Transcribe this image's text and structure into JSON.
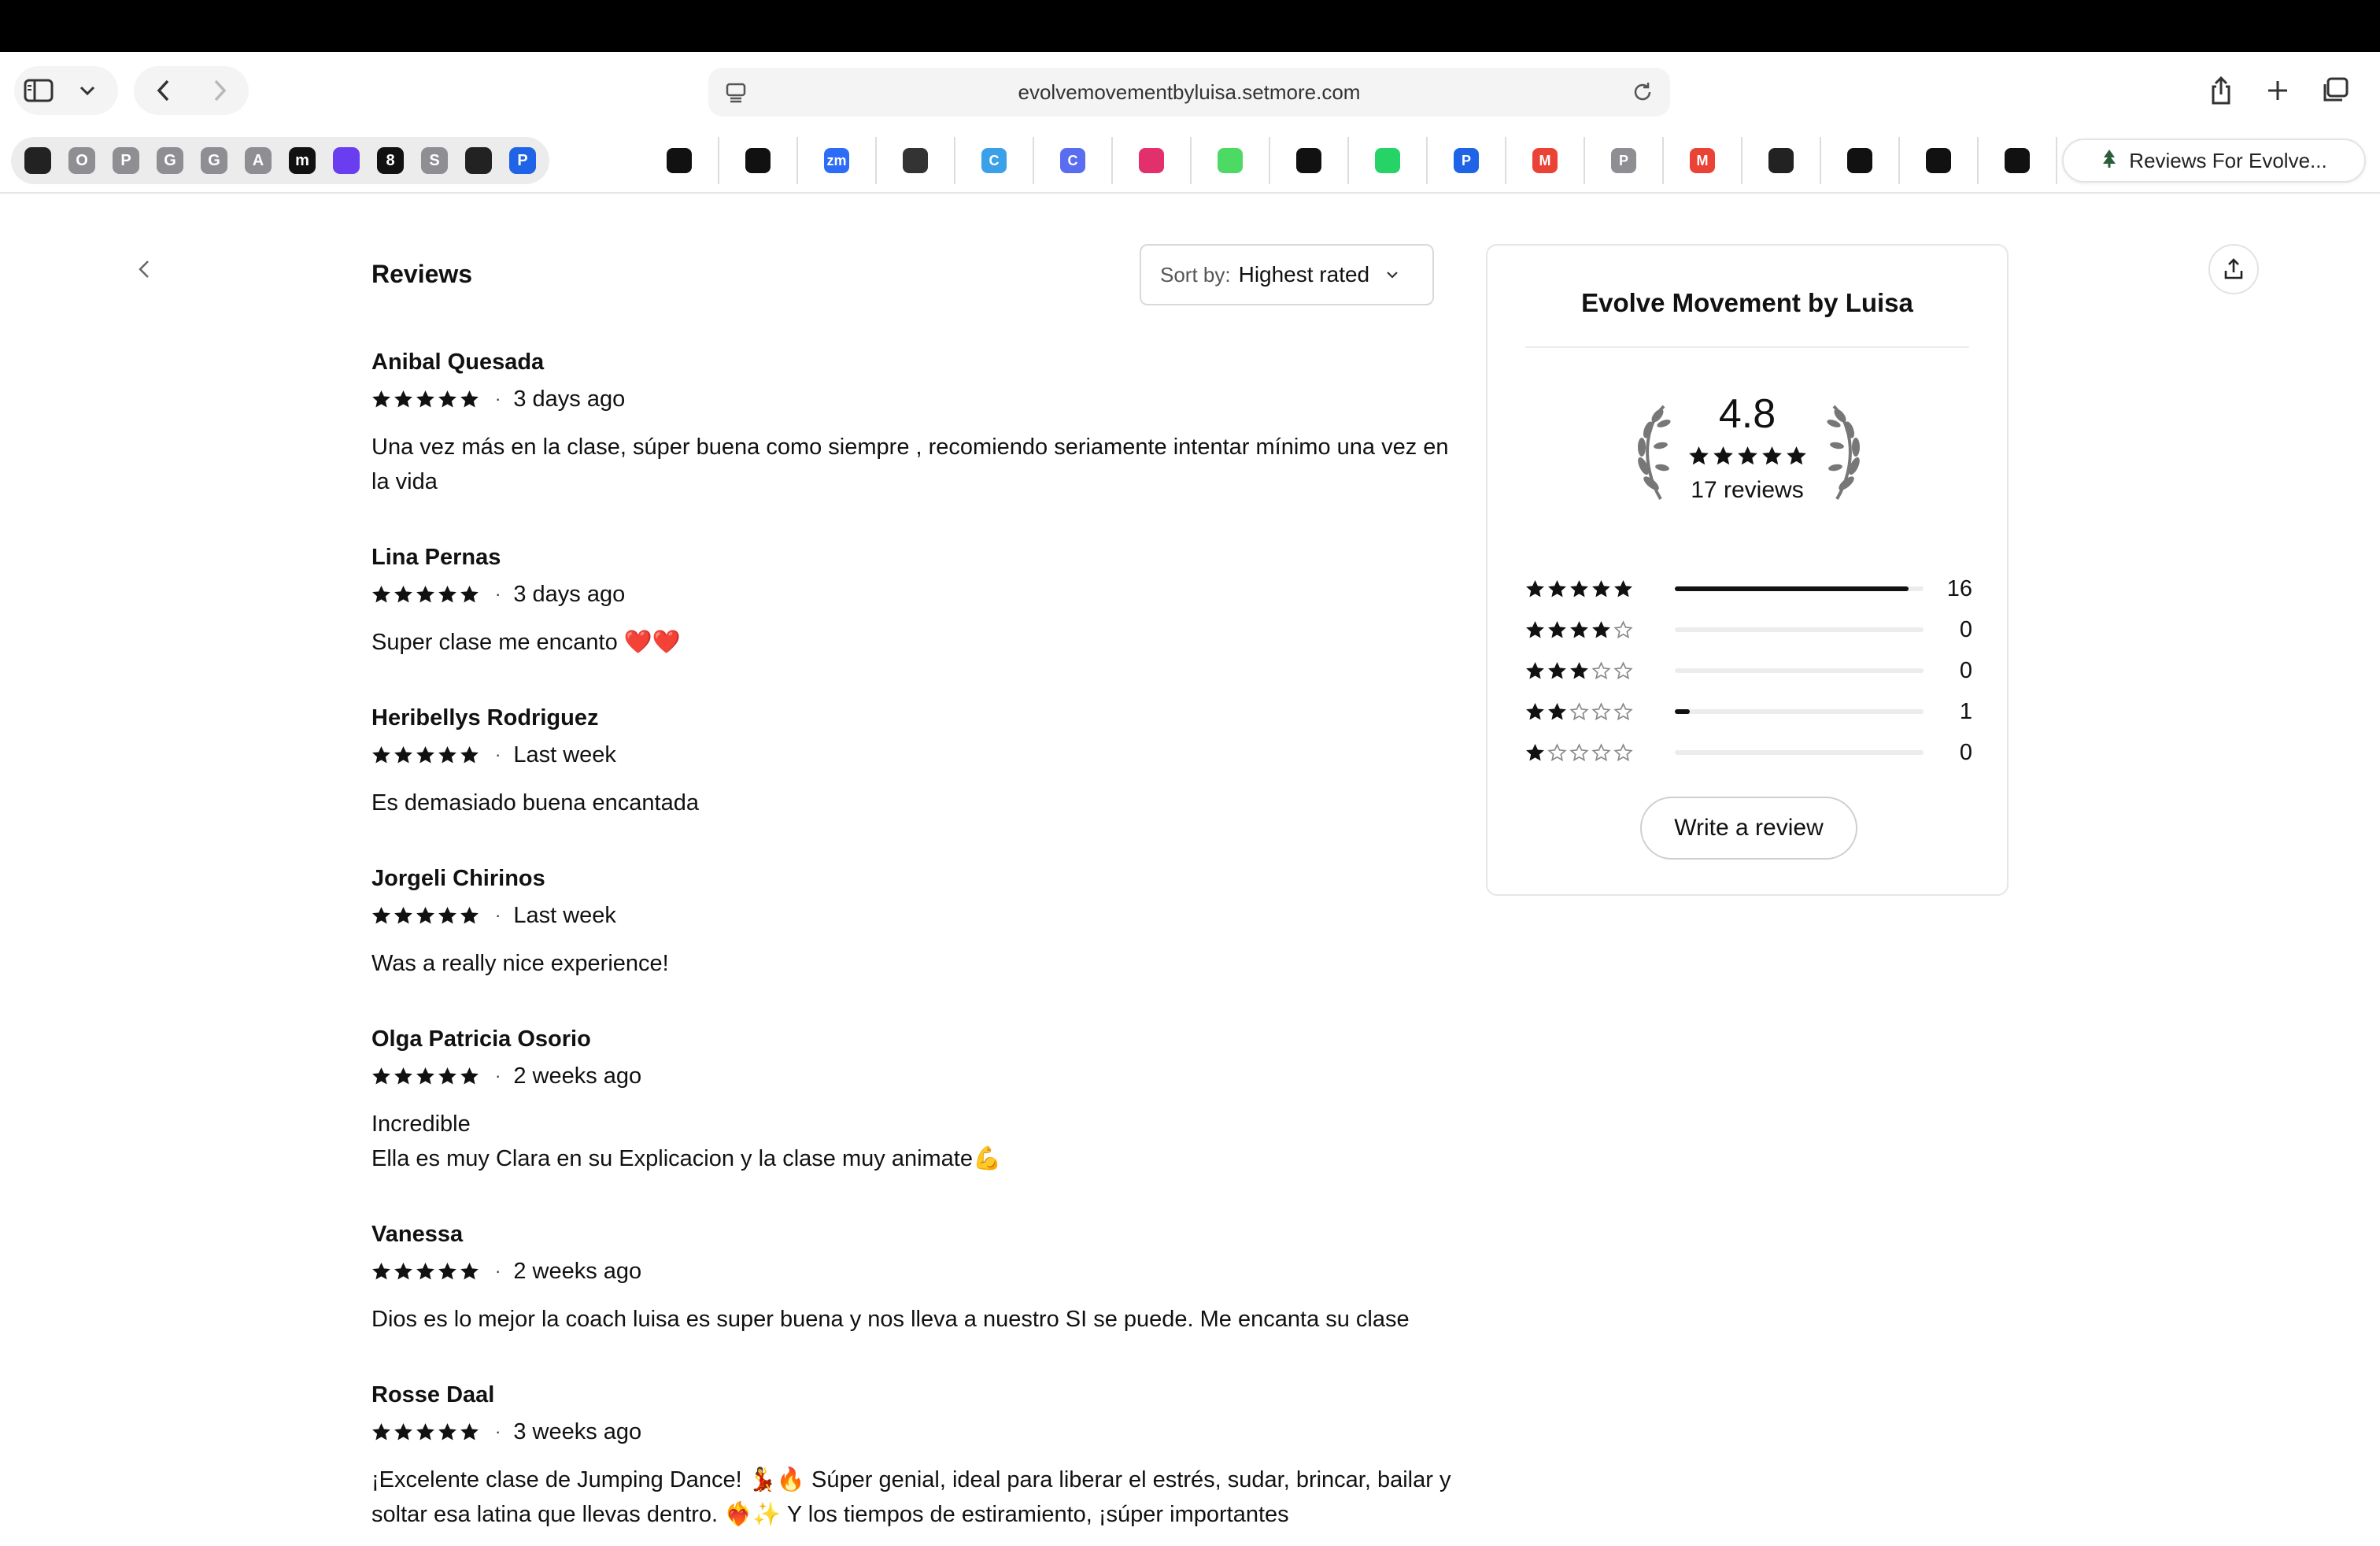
{
  "browser": {
    "url": "evolvemovementbyluisa.setmore.com",
    "active_tab_title": "Reviews For Evolve...",
    "pinned_tabs": [
      {
        "icon": "aperture-icon",
        "letter": "",
        "color": "#222222"
      },
      {
        "icon": "letter-o-icon",
        "letter": "O",
        "color": "#8e8e93"
      },
      {
        "icon": "letter-p-icon",
        "letter": "P",
        "color": "#8e8e93"
      },
      {
        "icon": "letter-g-icon",
        "letter": "G",
        "color": "#8e8e93"
      },
      {
        "icon": "letter-g-icon",
        "letter": "G",
        "color": "#8e8e93"
      },
      {
        "icon": "letter-a-icon",
        "letter": "A",
        "color": "#8e8e93"
      },
      {
        "icon": "m-logo-icon",
        "letter": "m",
        "color": "#111111"
      },
      {
        "icon": "purple-square-icon",
        "letter": "",
        "color": "#6a3df0"
      },
      {
        "icon": "number-8-icon",
        "letter": "8",
        "color": "#111111"
      },
      {
        "icon": "letter-s-icon",
        "letter": "S",
        "color": "#8e8e93"
      },
      {
        "icon": "hexagon-logo-icon",
        "letter": "",
        "color": "#222222"
      },
      {
        "icon": "paypal-icon",
        "letter": "P",
        "color": "#1f63e6"
      }
    ],
    "tabs": [
      {
        "icon": "dark-app-icon",
        "letter": "",
        "color": "#111111"
      },
      {
        "icon": "dark-app-icon",
        "letter": "",
        "color": "#111111"
      },
      {
        "icon": "zoom-icon",
        "letter": "zm",
        "color": "#2d6cf6"
      },
      {
        "icon": "openai-icon",
        "letter": "",
        "color": "#333333"
      },
      {
        "icon": "canva-icon",
        "letter": "C",
        "color": "#3aa0e8"
      },
      {
        "icon": "canva-icon",
        "letter": "C",
        "color": "#5a6cf0"
      },
      {
        "icon": "instagram-icon",
        "letter": "",
        "color": "#e1306c"
      },
      {
        "icon": "green-star-icon",
        "letter": "",
        "color": "#4cd964"
      },
      {
        "icon": "dark-app-icon",
        "letter": "",
        "color": "#111111"
      },
      {
        "icon": "whatsapp-icon",
        "letter": "",
        "color": "#25d366"
      },
      {
        "icon": "paypal-icon",
        "letter": "P",
        "color": "#1f63e6"
      },
      {
        "icon": "gmail-icon",
        "letter": "M",
        "color": "#ea4335"
      },
      {
        "icon": "letter-p-icon",
        "letter": "P",
        "color": "#8e8e93"
      },
      {
        "icon": "gmail-icon",
        "letter": "M",
        "color": "#ea4335"
      },
      {
        "icon": "aperture-icon",
        "letter": "",
        "color": "#222222"
      },
      {
        "icon": "dark-app-icon",
        "letter": "",
        "color": "#111111"
      },
      {
        "icon": "dark-app-icon",
        "letter": "",
        "color": "#111111"
      },
      {
        "icon": "dark-app-icon",
        "letter": "",
        "color": "#111111"
      }
    ]
  },
  "page": {
    "title": "Reviews",
    "sort": {
      "label": "Sort by:",
      "value": "Highest rated"
    }
  },
  "reviews": [
    {
      "name": "Anibal Quesada",
      "rating": 5,
      "time": "3 days ago",
      "body": "Una vez más en la clase, súper buena como siempre , recomiendo seriamente intentar mínimo una vez en la vida"
    },
    {
      "name": "Lina Pernas",
      "rating": 5,
      "time": "3 days ago",
      "body": "Super clase me encanto ❤️❤️"
    },
    {
      "name": "Heribellys Rodriguez",
      "rating": 5,
      "time": "Last week",
      "body": "Es demasiado buena encantada"
    },
    {
      "name": "Jorgeli Chirinos",
      "rating": 5,
      "time": "Last week",
      "body": "Was a really nice experience!"
    },
    {
      "name": "Olga Patricia Osorio",
      "rating": 5,
      "time": "2 weeks ago",
      "body": "Incredible\nElla es muy Clara en su Explicacion y la clase muy animate💪"
    },
    {
      "name": "Vanessa",
      "rating": 5,
      "time": "2 weeks ago",
      "body": "Dios es lo mejor la coach luisa es super buena y nos lleva a nuestro SI se puede. Me encanta su clase"
    },
    {
      "name": "Rosse Daal",
      "rating": 5,
      "time": "3 weeks ago",
      "body": "¡Excelente clase de Jumping Dance! 💃🔥 Súper genial, ideal para liberar el estrés, sudar, brincar, bailar y soltar esa latina que llevas dentro. ❤️‍🔥✨ Y los tiempos de estiramiento, ¡súper importantes"
    }
  ],
  "summary": {
    "business_name": "Evolve Movement by Luisa",
    "average": "4.8",
    "average_value": 4.8,
    "count_label": "17 reviews",
    "distribution": [
      {
        "stars": 5,
        "count": "16",
        "fraction": 0.94
      },
      {
        "stars": 4,
        "count": "0",
        "fraction": 0
      },
      {
        "stars": 3,
        "count": "0",
        "fraction": 0
      },
      {
        "stars": 2,
        "count": "1",
        "fraction": 0.06
      },
      {
        "stars": 1,
        "count": "0",
        "fraction": 0
      }
    ],
    "write_review_label": "Write a review"
  }
}
